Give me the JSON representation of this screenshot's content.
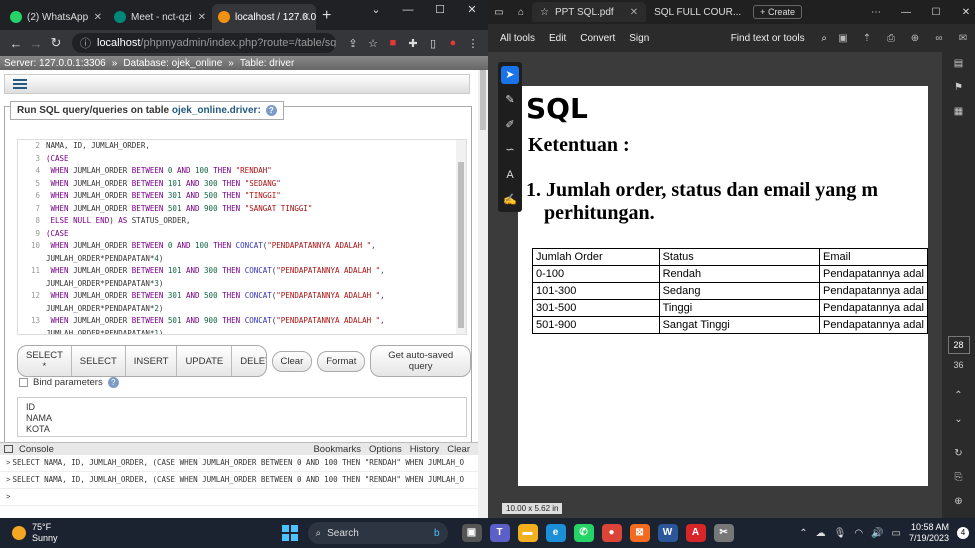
{
  "browser": {
    "tabs": [
      {
        "label": "(2) WhatsApp",
        "color": "#25d366"
      },
      {
        "label": "Meet - nct-qzi",
        "color": "#00897b"
      },
      {
        "label": "localhost / 127.0.0",
        "color": "#f29111"
      }
    ],
    "new_tab": "+",
    "url_host": "localhost",
    "url_path": "/phpmyadmin/index.php?route=/table/sql&db=oje..."
  },
  "pma": {
    "breadcrumb": {
      "server": "Server: 127.0.0.1:3306",
      "database": "Database: ojek_online",
      "table": "Table: driver"
    },
    "query_title_prefix": "Run SQL query/queries on table",
    "query_title_db": "ojek_online.driver:",
    "editor_lines": [
      {
        "n": "2",
        "html": "NAMA, ID, JUMLAH_ORDER,"
      },
      {
        "n": "3",
        "html": "<span class=\"kw\">(CASE</span>"
      },
      {
        "n": "4",
        "html": " <span class=\"kw\">WHEN</span> JUMLAH_ORDER <span class=\"kw\">BETWEEN</span> <span class=\"num\">0</span> <span class=\"kw\">AND</span> <span class=\"num\">100</span> <span class=\"kw\">THEN</span> <span class=\"str\">\"RENDAH\"</span>"
      },
      {
        "n": "5",
        "html": " <span class=\"kw\">WHEN</span> JUMLAH_ORDER <span class=\"kw\">BETWEEN</span> <span class=\"num\">101</span> <span class=\"kw\">AND</span> <span class=\"num\">300</span> <span class=\"kw\">THEN</span> <span class=\"str\">\"SEDANG\"</span>"
      },
      {
        "n": "6",
        "html": " <span class=\"kw\">WHEN</span> JUMLAH_ORDER <span class=\"kw\">BETWEEN</span> <span class=\"num\">301</span> <span class=\"kw\">AND</span> <span class=\"num\">500</span> <span class=\"kw\">THEN</span> <span class=\"str\">\"TINGGI\"</span>"
      },
      {
        "n": "7",
        "html": " <span class=\"kw\">WHEN</span> JUMLAH_ORDER <span class=\"kw\">BETWEEN</span> <span class=\"num\">501</span> <span class=\"kw\">AND</span> <span class=\"num\">900</span> <span class=\"kw\">THEN</span> <span class=\"str\">\"SANGAT TINGGI\"</span>"
      },
      {
        "n": "8",
        "html": " <span class=\"kw\">ELSE</span> <span class=\"kw\">NULL</span> <span class=\"kw\">END</span>) <span class=\"kw\">AS</span> STATUS_ORDER,"
      },
      {
        "n": "9",
        "html": "<span class=\"kw\">(CASE</span>"
      },
      {
        "n": "10",
        "html": " <span class=\"kw\">WHEN</span> JUMLAH_ORDER <span class=\"kw\">BETWEEN</span> <span class=\"num\">0</span> <span class=\"kw\">AND</span> <span class=\"num\">100</span> <span class=\"kw\">THEN</span> <span class=\"kwb\">CONCAT</span>(<span class=\"str\">\"PENDAPATANNYA ADALAH \"</span>,"
      },
      {
        "n": "",
        "html": "JUMLAH_ORDER*PENDAPATAN*<span class=\"num\">4</span>)"
      },
      {
        "n": "11",
        "html": " <span class=\"kw\">WHEN</span> JUMLAH_ORDER <span class=\"kw\">BETWEEN</span> <span class=\"num\">101</span> <span class=\"kw\">AND</span> <span class=\"num\">300</span> <span class=\"kw\">THEN</span> <span class=\"kwb\">CONCAT</span>(<span class=\"str\">\"PENDAPATANNYA ADALAH \"</span>,"
      },
      {
        "n": "",
        "html": "JUMLAH_ORDER*PENDAPATAN*<span class=\"num\">3</span>)"
      },
      {
        "n": "12",
        "html": " <span class=\"kw\">WHEN</span> JUMLAH_ORDER <span class=\"kw\">BETWEEN</span> <span class=\"num\">301</span> <span class=\"kw\">AND</span> <span class=\"num\">500</span> <span class=\"kw\">THEN</span> <span class=\"kwb\">CONCAT</span>(<span class=\"str\">\"PENDAPATANNYA ADALAH \"</span>,"
      },
      {
        "n": "",
        "html": "JUMLAH_ORDER*PENDAPATAN*<span class=\"num\">2</span>)"
      },
      {
        "n": "13",
        "html": " <span class=\"kw\">WHEN</span> JUMLAH_ORDER <span class=\"kw\">BETWEEN</span> <span class=\"num\">501</span> <span class=\"kw\">AND</span> <span class=\"num\">900</span> <span class=\"kw\">THEN</span> <span class=\"kwb\">CONCAT</span>(<span class=\"str\">\"PENDAPATANNYA ADALAH \"</span>,"
      },
      {
        "n": "",
        "html": "JUMLAH_ORDER*PENDAPATAN*<span class=\"num\">1</span>)"
      }
    ],
    "buttons": {
      "select_star": "SELECT *",
      "select": "SELECT",
      "insert": "INSERT",
      "update": "UPDATE",
      "delete": "DELETE",
      "clear": "Clear",
      "format": "Format",
      "autosaved": "Get auto-saved query"
    },
    "bind_params": "Bind parameters",
    "columns": [
      "ID",
      "NAMA",
      "KOTA"
    ],
    "console": {
      "label": "Console",
      "links": [
        "Bookmarks",
        "Options",
        "History",
        "Clear"
      ],
      "lines": [
        "SELECT NAMA, ID, JUMLAH_ORDER, (CASE WHEN JUMLAH_ORDER BETWEEN 0 AND 100 THEN \"RENDAH\" WHEN JUMLAH_O",
        "SELECT NAMA, ID, JUMLAH_ORDER, (CASE WHEN JUMLAH_ORDER BETWEEN 0 AND 100 THEN \"RENDAH\" WHEN JUMLAH_O"
      ],
      "prompt": ">"
    }
  },
  "pdf": {
    "tabs": [
      "PPT SQL.pdf",
      "SQL FULL COUR..."
    ],
    "create": "Create",
    "toolbar": [
      "All tools",
      "Edit",
      "Convert",
      "Sign"
    ],
    "find": "Find text or tools",
    "title": "SQL",
    "subtitle": "Ketentuan :",
    "item_num": "1.",
    "item_line1": "Jumlah order, status dan email yang m",
    "item_line2": "perhitungan.",
    "table": {
      "headers": [
        "Jumlah Order",
        "Status",
        "Email"
      ],
      "rows": [
        [
          "0-100",
          "Rendah",
          "Pendapatannya adal"
        ],
        [
          "101-300",
          "Sedang",
          "Pendapatannya adal"
        ],
        [
          "301-500",
          "Tinggi",
          "Pendapatannya adal"
        ],
        [
          "501-900",
          "Sangat Tinggi",
          "Pendapatannya adal"
        ]
      ]
    },
    "page_size": "10.00 x 5.62 in",
    "page_current": "28",
    "page_total": "36"
  },
  "taskbar": {
    "temp": "75°F",
    "condition": "Sunny",
    "search": "Search",
    "time": "10:58 AM",
    "date": "7/19/2023",
    "notif_count": "4"
  }
}
